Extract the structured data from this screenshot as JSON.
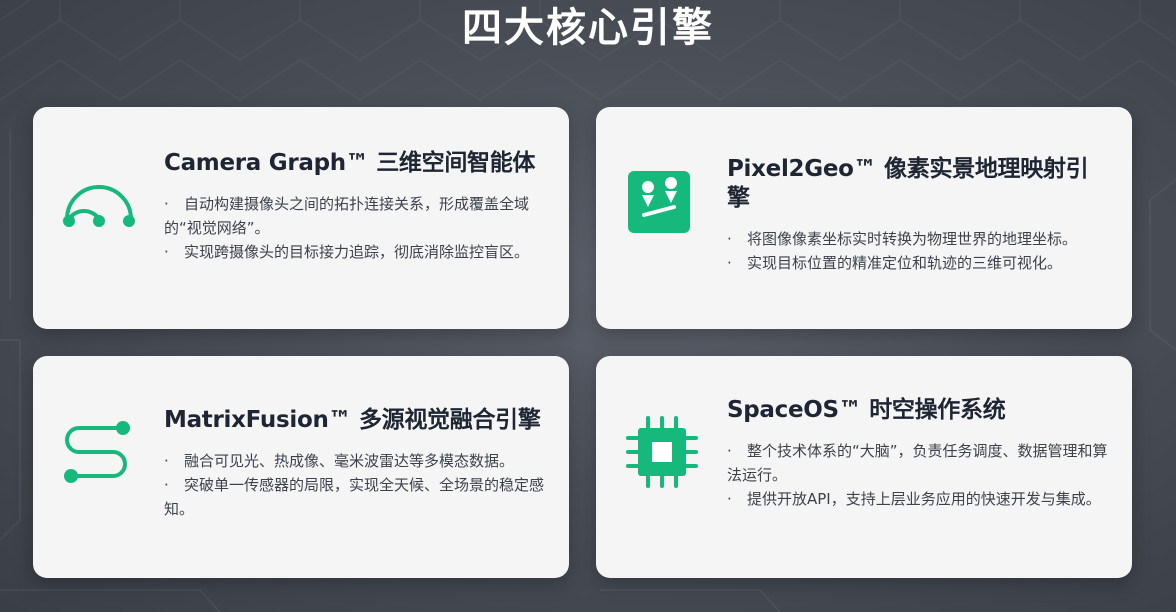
{
  "page": {
    "title": "四大核心引擎",
    "accent_color": "#16b97c",
    "card_bg": "#f5f5f6",
    "title_color": "#ffffff"
  },
  "cards": [
    {
      "icon": "network-arc-icon",
      "title": "Camera Graph™ 三维空间智能体",
      "bullets": [
        "自动构建摄像头之间的拓扑连接关系，形成覆盖全域的“视觉网络”。",
        "实现跨摄像头的目标接力追踪，彻底消除监控盲区。"
      ]
    },
    {
      "icon": "map-pin-icon",
      "title": "Pixel2Geo™ 像素实景地理映射引擎",
      "bullets": [
        "将图像像素坐标实时转换为物理世界的地理坐标。",
        "实现目标位置的精准定位和轨迹的三维可视化。"
      ]
    },
    {
      "icon": "path-s-icon",
      "title": "MatrixFusion™ 多源视觉融合引擎",
      "bullets": [
        "融合可见光、热成像、毫米波雷达等多模态数据。",
        "突破单一传感器的局限，实现全天候、全场景的稳定感知。"
      ]
    },
    {
      "icon": "chip-icon",
      "title": "SpaceOS™ 时空操作系统",
      "bullets": [
        "整个技术体系的“大脑”，负责任务调度、数据管理和算法运行。",
        "提供开放API，支持上层业务应用的快速开发与集成。"
      ]
    }
  ]
}
